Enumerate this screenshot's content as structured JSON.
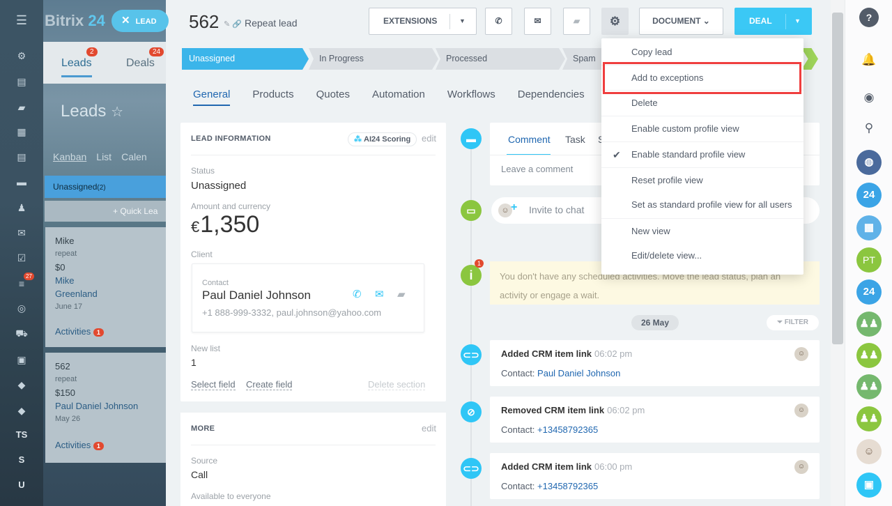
{
  "left_rail": {
    "badge": "27",
    "letters": [
      "TS",
      "S",
      "U"
    ]
  },
  "background": {
    "logo": "Bitrix",
    "logo_suffix": "24",
    "lead_pill": "LEAD",
    "tabs": [
      {
        "label": "Leads",
        "badge": "2"
      },
      {
        "label": "Deals",
        "badge": "24"
      }
    ],
    "title": "Leads",
    "views": [
      "Kanban",
      "List",
      "Calen"
    ],
    "column": {
      "label": "Unassigned",
      "count": "(2)"
    },
    "quick_lead": "+ Quick Lea",
    "cards": [
      {
        "title": "Mike",
        "type": "repeat",
        "amount": "$0",
        "client_line1": "Mike",
        "client_line2": "Greenland",
        "date": "June 17",
        "activities": "Activities",
        "count": "1"
      },
      {
        "title": "562",
        "type": "repeat",
        "amount": "$150",
        "client_line1": "Paul Daniel Johnson",
        "client_line2": "",
        "date": "May 26",
        "activities": "Activities",
        "count": "1"
      }
    ]
  },
  "header": {
    "id": "562",
    "subtitle": "Repeat lead",
    "extensions": "EXTENSIONS",
    "document": "DOCUMENT",
    "deal": "DEAL"
  },
  "stages": [
    "Unassigned",
    "In Progress",
    "Processed",
    "Spam"
  ],
  "tabs": [
    "General",
    "Products",
    "Quotes",
    "Automation",
    "Workflows",
    "Dependencies"
  ],
  "lead_info": {
    "heading": "LEAD INFORMATION",
    "ai_badge": "AI24 Scoring",
    "edit": "edit",
    "status_label": "Status",
    "status_value": "Unassigned",
    "amount_label": "Amount and currency",
    "currency": "€",
    "amount": "1,350",
    "client_label": "Client",
    "contact_label": "Contact",
    "contact_name": "Paul Daniel Johnson",
    "contact_meta": "+1 888-999-3332, paul.johnson@yahoo.com",
    "new_list_label": "New list",
    "new_list_value": "1",
    "select_field": "Select field",
    "create_field": "Create field",
    "delete_section": "Delete section"
  },
  "more": {
    "heading": "MORE",
    "edit": "edit",
    "source_label": "Source",
    "source_value": "Call",
    "available": "Available to everyone"
  },
  "timeline": {
    "composer_tabs": [
      "Comment",
      "Task",
      "S"
    ],
    "comment_placeholder": "Leave a comment",
    "invite": "Invite to chat",
    "scheduled_line1": "You don't have any scheduled activities. Move the lead status, plan an",
    "scheduled_line2": "activity or engage a wait.",
    "scheduled_badge": "1",
    "date": "26 May",
    "filter": "FILTER",
    "events": [
      {
        "title": "Added CRM item link",
        "time": "06:02 pm",
        "label": "Contact:",
        "value": "Paul Daniel Johnson"
      },
      {
        "title": "Removed CRM item link",
        "time": "06:02 pm",
        "label": "Contact:",
        "value": "+13458792365"
      },
      {
        "title": "Added CRM item link",
        "time": "06:00 pm",
        "label": "Contact:",
        "value": "+13458792365"
      }
    ]
  },
  "dropdown": {
    "items": [
      "Copy lead",
      "Add to exceptions",
      "Delete",
      "Enable custom profile view",
      "Enable standard profile view",
      "Reset profile view",
      "Set as standard profile view for all users",
      "New view",
      "Edit/delete view..."
    ],
    "highlighted_item": "Add to exceptions",
    "checked_item": "Enable standard profile view"
  },
  "right_bar": {
    "items": [
      "24",
      "PT",
      "24"
    ]
  },
  "colors": {
    "accent": "#3bc8f5",
    "active_stage": "#3bb5ea",
    "highlight_border": "#ef3e3e",
    "badge": "#e2492f"
  }
}
